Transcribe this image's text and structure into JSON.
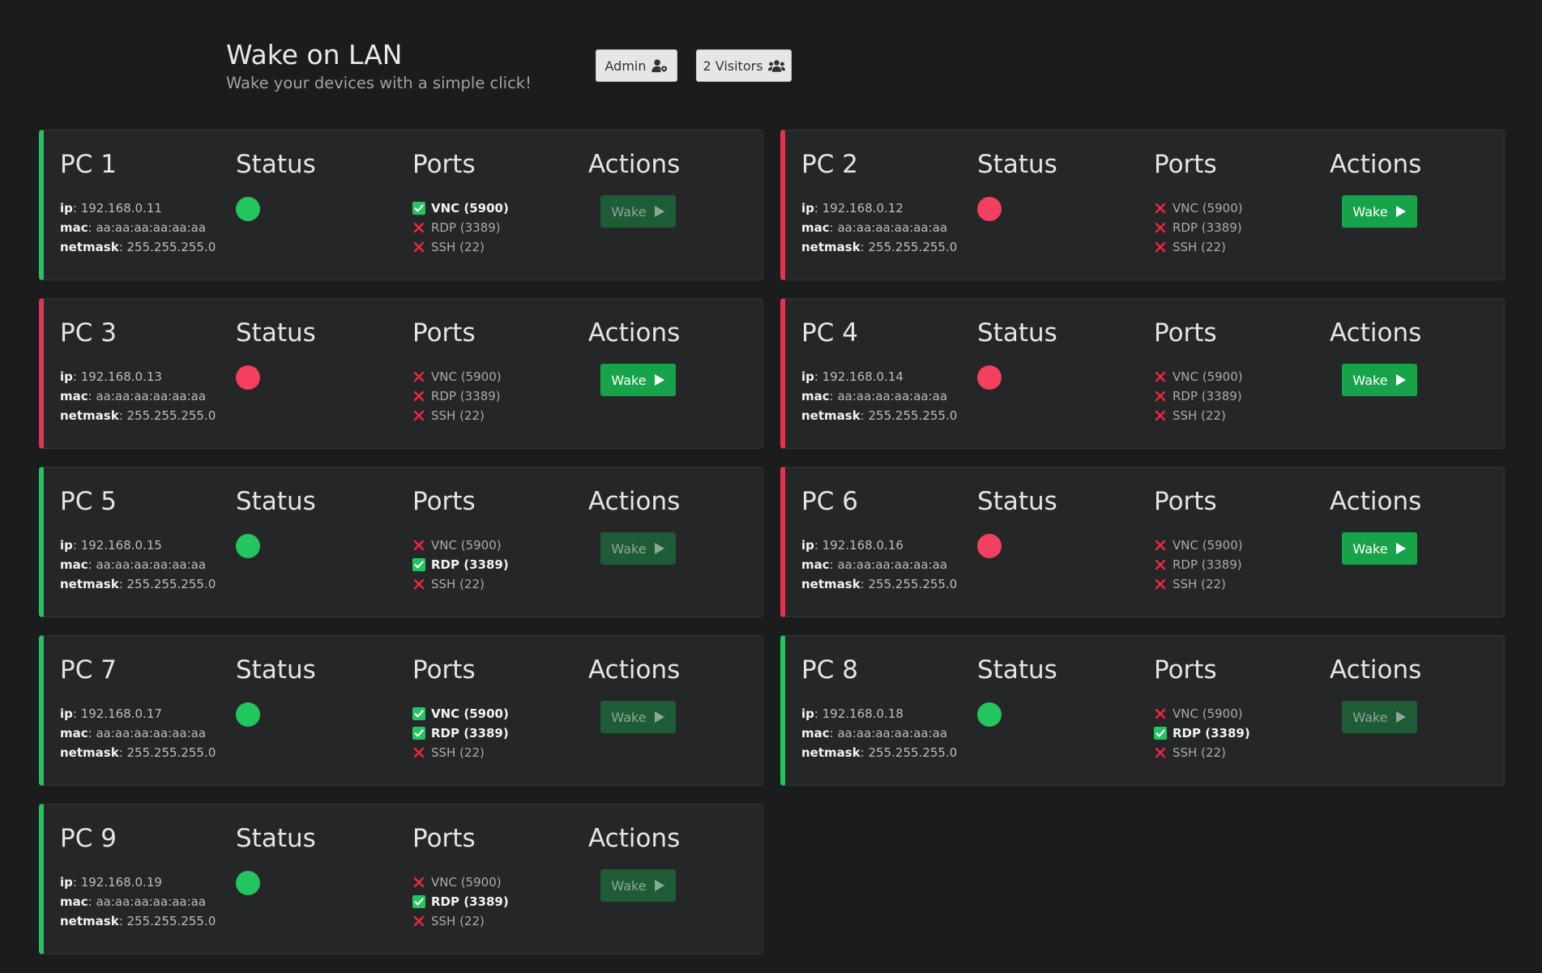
{
  "header": {
    "title": "Wake on LAN",
    "subtitle": "Wake your devices with a simple click!",
    "admin_label": "Admin",
    "visitors_label": "2 Visitors"
  },
  "labels": {
    "status": "Status",
    "ports": "Ports",
    "actions": "Actions",
    "wake": "Wake",
    "ip": "ip",
    "mac": "mac",
    "netmask": "netmask"
  },
  "colors": {
    "online": "#22c55e",
    "offline": "#f43f5e",
    "wake_button": "#16a34a"
  },
  "devices": [
    {
      "name": "PC 1",
      "ip": "192.168.0.11",
      "mac": "aa:aa:aa:aa:aa:aa",
      "netmask": "255.255.255.0",
      "online": true,
      "ports": [
        {
          "label": "VNC (5900)",
          "open": true
        },
        {
          "label": "RDP (3389)",
          "open": false
        },
        {
          "label": "SSH (22)",
          "open": false
        }
      ]
    },
    {
      "name": "PC 2",
      "ip": "192.168.0.12",
      "mac": "aa:aa:aa:aa:aa:aa",
      "netmask": "255.255.255.0",
      "online": false,
      "ports": [
        {
          "label": "VNC (5900)",
          "open": false
        },
        {
          "label": "RDP (3389)",
          "open": false
        },
        {
          "label": "SSH (22)",
          "open": false
        }
      ]
    },
    {
      "name": "PC 3",
      "ip": "192.168.0.13",
      "mac": "aa:aa:aa:aa:aa:aa",
      "netmask": "255.255.255.0",
      "online": false,
      "ports": [
        {
          "label": "VNC (5900)",
          "open": false
        },
        {
          "label": "RDP (3389)",
          "open": false
        },
        {
          "label": "SSH (22)",
          "open": false
        }
      ]
    },
    {
      "name": "PC 4",
      "ip": "192.168.0.14",
      "mac": "aa:aa:aa:aa:aa:aa",
      "netmask": "255.255.255.0",
      "online": false,
      "ports": [
        {
          "label": "VNC (5900)",
          "open": false
        },
        {
          "label": "RDP (3389)",
          "open": false
        },
        {
          "label": "SSH (22)",
          "open": false
        }
      ]
    },
    {
      "name": "PC 5",
      "ip": "192.168.0.15",
      "mac": "aa:aa:aa:aa:aa:aa",
      "netmask": "255.255.255.0",
      "online": true,
      "ports": [
        {
          "label": "VNC (5900)",
          "open": false
        },
        {
          "label": "RDP (3389)",
          "open": true
        },
        {
          "label": "SSH (22)",
          "open": false
        }
      ]
    },
    {
      "name": "PC 6",
      "ip": "192.168.0.16",
      "mac": "aa:aa:aa:aa:aa:aa",
      "netmask": "255.255.255.0",
      "online": false,
      "ports": [
        {
          "label": "VNC (5900)",
          "open": false
        },
        {
          "label": "RDP (3389)",
          "open": false
        },
        {
          "label": "SSH (22)",
          "open": false
        }
      ]
    },
    {
      "name": "PC 7",
      "ip": "192.168.0.17",
      "mac": "aa:aa:aa:aa:aa:aa",
      "netmask": "255.255.255.0",
      "online": true,
      "ports": [
        {
          "label": "VNC (5900)",
          "open": true
        },
        {
          "label": "RDP (3389)",
          "open": true
        },
        {
          "label": "SSH (22)",
          "open": false
        }
      ]
    },
    {
      "name": "PC 8",
      "ip": "192.168.0.18",
      "mac": "aa:aa:aa:aa:aa:aa",
      "netmask": "255.255.255.0",
      "online": true,
      "ports": [
        {
          "label": "VNC (5900)",
          "open": false
        },
        {
          "label": "RDP (3389)",
          "open": true
        },
        {
          "label": "SSH (22)",
          "open": false
        }
      ]
    },
    {
      "name": "PC 9",
      "ip": "192.168.0.19",
      "mac": "aa:aa:aa:aa:aa:aa",
      "netmask": "255.255.255.0",
      "online": true,
      "ports": [
        {
          "label": "VNC (5900)",
          "open": false
        },
        {
          "label": "RDP (3389)",
          "open": true
        },
        {
          "label": "SSH (22)",
          "open": false
        }
      ]
    }
  ]
}
